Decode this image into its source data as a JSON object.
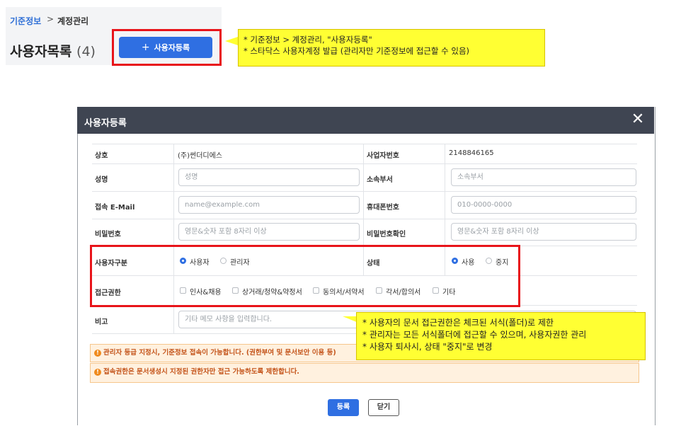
{
  "breadcrumb": {
    "parent": "기준정보",
    "separator": ">",
    "current": "계정관리"
  },
  "list": {
    "title": "사용자목록",
    "count": "(4)"
  },
  "register_button": {
    "label": "사용자등록",
    "icon": "plus-icon"
  },
  "note_top": {
    "line1": "* 기준정보 > 계정관리, \"사용자등록\"",
    "line2": "* 스타닥스 사용자계정 발급 (관리자만 기준정보에 접근할 수 있음)"
  },
  "modal": {
    "title": "사용자등록",
    "close_icon": "close-icon",
    "company": {
      "label": "상호",
      "value": "(주)썬더디에스"
    },
    "bizno": {
      "label": "사업자번호",
      "value": "2148846165"
    },
    "name": {
      "label": "성명",
      "placeholder": "성명"
    },
    "department": {
      "label": "소속부서",
      "placeholder": "소속부서"
    },
    "email": {
      "label": "접속 E-Mail",
      "placeholder": "name@example.com"
    },
    "phone": {
      "label": "휴대폰번호",
      "placeholder": "010-0000-0000"
    },
    "password": {
      "label": "비밀번호",
      "placeholder": "영문&숫자 포함 8자리 이상"
    },
    "password_confirm": {
      "label": "비밀번호확인",
      "placeholder": "영문&숫자 포함 8자리 이상"
    },
    "user_type": {
      "label": "사용자구분",
      "options": [
        "사용자",
        "관리자"
      ],
      "selected": "사용자"
    },
    "status": {
      "label": "상태",
      "options": [
        "사용",
        "중지"
      ],
      "selected": "사용"
    },
    "access": {
      "label": "접근권한",
      "options": [
        "인사&채용",
        "상거래/청약&약정서",
        "동의서/서약서",
        "각서/합의서",
        "기타"
      ]
    },
    "memo": {
      "label": "비고",
      "placeholder": "기타 메모 사항을 입력합니다."
    },
    "notices": [
      "관리자 등급 지정시, 기준정보 접속이 가능합니다. (권한부여 및 문서보안 이용 등)",
      "접속권한은 문서생성시 지정된 권한자만 접근 가능하도록 제한합니다."
    ],
    "buttons": {
      "submit": "등록",
      "close": "닫기"
    }
  },
  "note_bottom": {
    "line1": "* 사용자의 문서 접근권한은 체크된 서식(폴더)로 제한",
    "line2": "* 관리자는 모든 서식폴더에 접근할 수 있으며, 사용자권한 관리",
    "line3": "* 사용자 퇴사시, 상태 \"중지\"로 변경"
  },
  "colors": {
    "primary": "#2f6fe2",
    "header": "#3f4552",
    "highlight": "#e8141a",
    "callout": "#ffff33",
    "notice": "#c4541a"
  }
}
